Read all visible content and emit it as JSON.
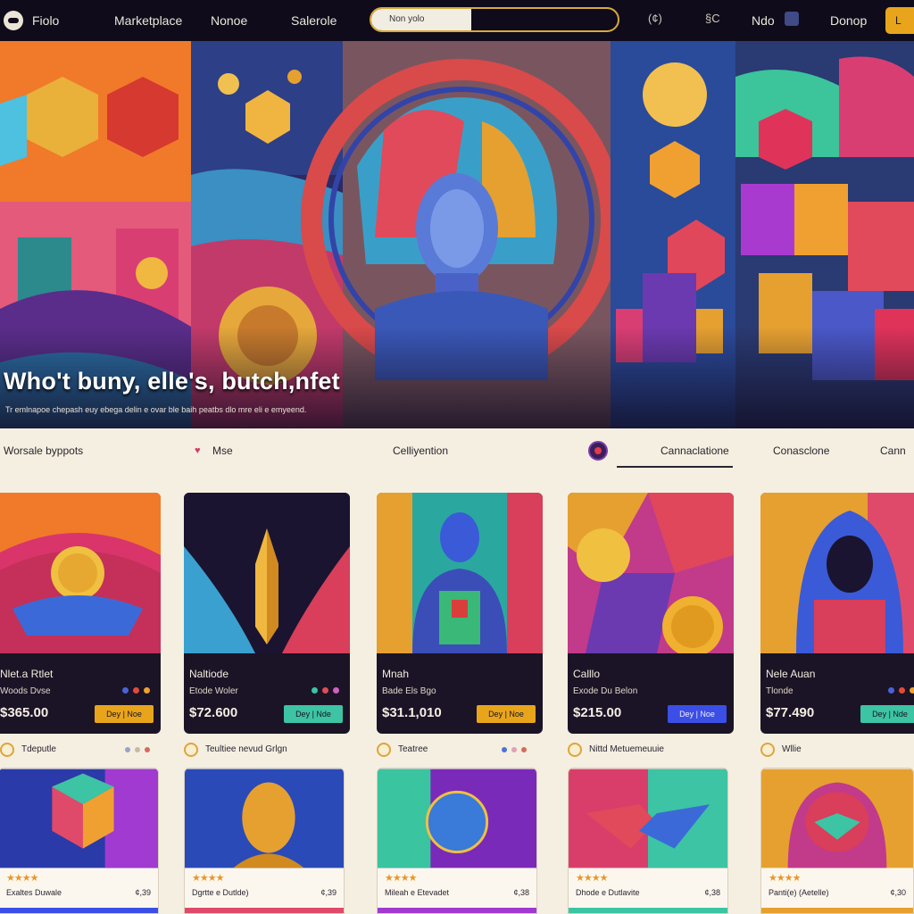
{
  "nav": {
    "brand": "Fiolo",
    "links": [
      "Marketplace",
      "Nonoe",
      "Salerole"
    ],
    "search_placeholder": "Non yolo",
    "icon_label_1": "(¢)",
    "icon_label_2": "§C",
    "account": "Ndo",
    "action": "Donop",
    "cta_label": "L"
  },
  "hero": {
    "title": "Who't buny, elle's, butch,nfet",
    "subtitle": "Tr emlnapoe chepash euy ebega delin e ovar ble baih peatbs dlo mre eli e emyeend."
  },
  "filters": {
    "left_label": "Worsale byppots",
    "heart_label": "Mse",
    "middle_label": "Celliyention",
    "active_tab": "Cannaclatione",
    "tab_2": "Conasclone",
    "tab_3": "Cann"
  },
  "colors": {
    "nav_bg": "#0f0b1a",
    "accent": "#e8a51c",
    "page_bg": "#f4efe0",
    "card_bg": "#1b1426",
    "button_gold": "#e8a51c",
    "button_teal": "#3cc4a4",
    "button_blue": "#3b4ee6",
    "star": "#e9962a"
  },
  "cards": [
    {
      "name": "Nlet.a Rtlet",
      "creator": "Woods Dvse",
      "price": "$365.00",
      "button": "Dey | Noe",
      "button_color": "#e8a51c",
      "dots": [
        "#4a62d8",
        "#e24a3a",
        "#f0a030"
      ]
    },
    {
      "name": "Naltiode",
      "creator": "Etode Woler",
      "price": "$72.600",
      "button": "Dey | Nde",
      "button_color": "#3cc4a4",
      "dots": []
    },
    {
      "name": "Mnah",
      "creator": "Bade Els Bgo",
      "price": "$31.1,010",
      "button": "Dey | Noe",
      "button_color": "#e8a51c",
      "dots": []
    },
    {
      "name": "Calllo",
      "creator": "Exode Du Belon",
      "price": "$215.00",
      "button": "Dey | Noe",
      "button_color": "#3b4ee6",
      "dots": []
    },
    {
      "name": "Nele Auan",
      "creator": "Tlonde",
      "price": "$77.490",
      "button": "Dey | Nde",
      "button_color": "#3cc4a4",
      "dots": [
        "#4a62d8",
        "#e24a3a",
        "#f0a030"
      ]
    }
  ],
  "owners": [
    {
      "name": "Tdeputle",
      "dots": [
        "#9aa3c8",
        "#c8b8a8",
        "#d66a5a"
      ]
    },
    {
      "name": "Teultiee nevud Grlgn",
      "dots": []
    },
    {
      "name": "Teatree",
      "dots": [
        "#4a72d8",
        "#e0a0b8",
        "#d86a5a"
      ]
    },
    {
      "name": "Nittd Metuemeuuie",
      "dots": []
    },
    {
      "name": "Wllie",
      "dots": []
    }
  ],
  "bottom_cards": [
    {
      "stars": "★★★★",
      "name": "Exaltes Duwale",
      "price": "¢,39"
    },
    {
      "stars": "★★★★",
      "name": "Dgrtte e Dutlde)",
      "price": "¢,39"
    },
    {
      "stars": "★★★★",
      "name": "Mileah e Etevadet",
      "price": "¢,38"
    },
    {
      "stars": "★★★★",
      "name": "Dhode e Dutlavite",
      "price": "¢,38"
    },
    {
      "stars": "★★★★",
      "name": "Panti(e) (Aetelle)",
      "price": "¢,30"
    }
  ]
}
